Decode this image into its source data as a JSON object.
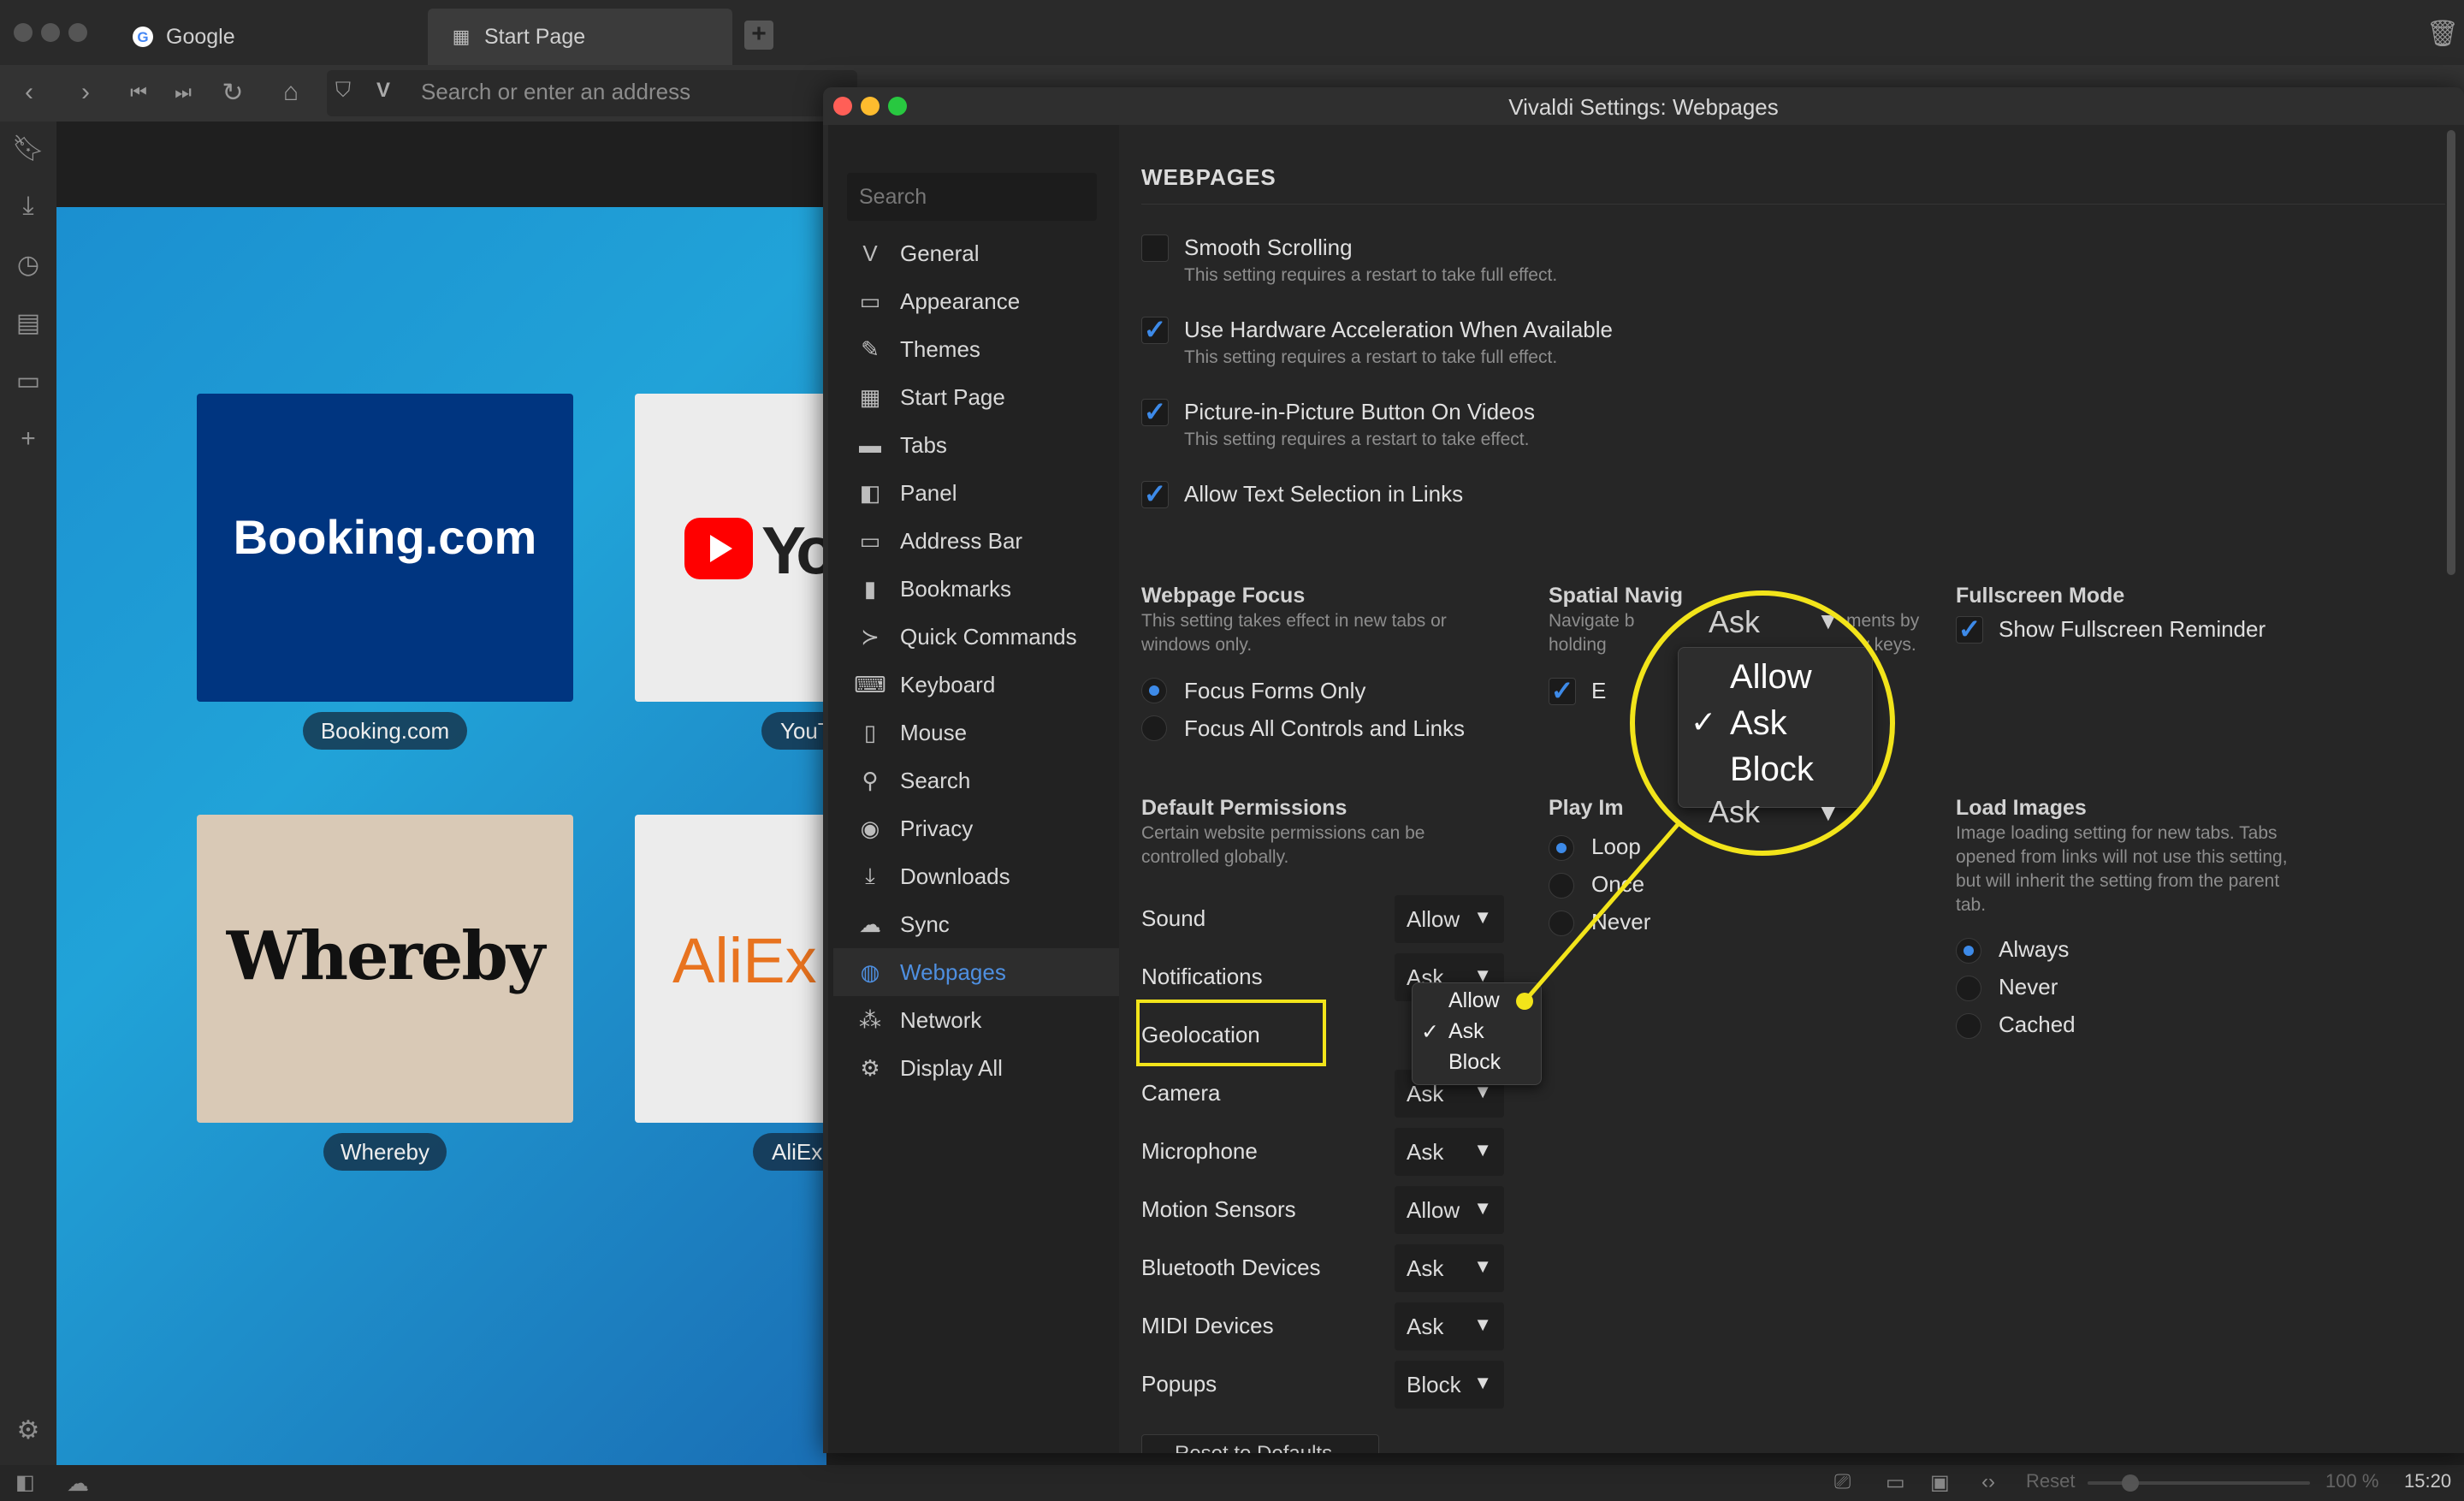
{
  "browser": {
    "tabs": [
      {
        "label": "Google",
        "icon": "google-icon"
      },
      {
        "label": "Start Page",
        "icon": "grid-icon"
      }
    ],
    "address_placeholder": "Search or enter an address",
    "speed_dials": [
      {
        "title": "Booking.com",
        "label": "Booking.com",
        "bg": "#003580",
        "fg": "#ffffff"
      },
      {
        "title": "You",
        "label": "YouT",
        "bg": "#ececec",
        "fg": "#222222"
      },
      {
        "title": "Whereby",
        "label": "Whereby",
        "bg": "#d9c9b6",
        "fg": "#111111"
      },
      {
        "title": "AliEx",
        "label": "AliEx",
        "bg": "#ececec",
        "fg": "#e8731f"
      }
    ],
    "status": {
      "reset_label": "Reset",
      "zoom": "100 %",
      "time": "15:20"
    }
  },
  "settings": {
    "window_title": "Vivaldi Settings: Webpages",
    "search_placeholder": "Search",
    "nav": [
      {
        "label": "General",
        "icon": "vivaldi-icon"
      },
      {
        "label": "Appearance",
        "icon": "folder-icon"
      },
      {
        "label": "Themes",
        "icon": "brush-icon"
      },
      {
        "label": "Start Page",
        "icon": "grid-icon"
      },
      {
        "label": "Tabs",
        "icon": "tabs-icon"
      },
      {
        "label": "Panel",
        "icon": "panel-icon"
      },
      {
        "label": "Address Bar",
        "icon": "address-bar-icon"
      },
      {
        "label": "Bookmarks",
        "icon": "bookmark-icon"
      },
      {
        "label": "Quick Commands",
        "icon": "quick-commands-icon"
      },
      {
        "label": "Keyboard",
        "icon": "keyboard-icon"
      },
      {
        "label": "Mouse",
        "icon": "mouse-icon"
      },
      {
        "label": "Search",
        "icon": "search-icon"
      },
      {
        "label": "Privacy",
        "icon": "eye-icon"
      },
      {
        "label": "Downloads",
        "icon": "download-icon"
      },
      {
        "label": "Sync",
        "icon": "cloud-icon"
      },
      {
        "label": "Webpages",
        "icon": "globe-icon",
        "active": true
      },
      {
        "label": "Network",
        "icon": "network-icon"
      },
      {
        "label": "Display All",
        "icon": "gear-icon"
      }
    ],
    "heading": "WEBPAGES",
    "checkboxes": [
      {
        "label": "Smooth Scrolling",
        "note": "This setting requires a restart to take full effect.",
        "checked": false
      },
      {
        "label": "Use Hardware Acceleration When Available",
        "note": "This setting requires a restart to take full effect.",
        "checked": true
      },
      {
        "label": "Picture-in-Picture Button On Videos",
        "note": "This setting requires a restart to take effect.",
        "checked": true
      },
      {
        "label": "Allow Text Selection in Links",
        "note": "",
        "checked": true
      }
    ],
    "webpage_focus": {
      "title": "Webpage Focus",
      "note_lines": [
        "This setting takes effect in new tabs or",
        "windows only."
      ],
      "options": [
        {
          "label": "Focus Forms Only",
          "selected": true
        },
        {
          "label": "Focus All Controls and Links",
          "selected": false
        }
      ]
    },
    "spatial": {
      "title": "Spatial Navig",
      "note_lines": [
        "Navigate b",
        "holding"
      ],
      "note_right": [
        "ments by",
        "ow keys."
      ],
      "check_label": "E"
    },
    "fullscreen": {
      "title": "Fullscreen Mode",
      "check_label": "Show Fullscreen Reminder"
    },
    "permissions": {
      "title": "Default Permissions",
      "note_lines": [
        "Certain website permissions can be",
        "controlled globally."
      ],
      "rows": [
        {
          "label": "Sound",
          "value": "Allow"
        },
        {
          "label": "Notifications",
          "value": "Ask"
        },
        {
          "label": "Geolocation",
          "value": ""
        },
        {
          "label": "Camera",
          "value": "Ask"
        },
        {
          "label": "Microphone",
          "value": "Ask"
        },
        {
          "label": "Motion Sensors",
          "value": "Allow"
        },
        {
          "label": "Bluetooth Devices",
          "value": "Ask"
        },
        {
          "label": "MIDI Devices",
          "value": "Ask"
        },
        {
          "label": "Popups",
          "value": "Block"
        }
      ],
      "geolocation_menu": [
        "Allow",
        "Ask",
        "Block"
      ],
      "geolocation_checked": "Ask",
      "reset_label": "Reset to Defaults"
    },
    "play_images": {
      "title": "Play Im",
      "options": [
        {
          "label": "Loop",
          "selected": true
        },
        {
          "label": "Once",
          "selected": false
        },
        {
          "label": "Never",
          "selected": false
        }
      ]
    },
    "load_images": {
      "title": "Load Images",
      "note_lines": [
        "Image loading setting for new tabs. Tabs",
        "opened from links will not use this setting,",
        "but will inherit the setting from the parent",
        "tab."
      ],
      "options": [
        {
          "label": "Always",
          "selected": true
        },
        {
          "label": "Never",
          "selected": false
        },
        {
          "label": "Cached",
          "selected": false
        }
      ]
    },
    "magnifier": {
      "top_value": "Ask",
      "items": [
        "Allow",
        "Ask",
        "Block"
      ],
      "checked": "Ask",
      "bottom_value": "Ask"
    },
    "accent_color": "#3d8ae8",
    "highlight_color": "#f2e41a"
  }
}
